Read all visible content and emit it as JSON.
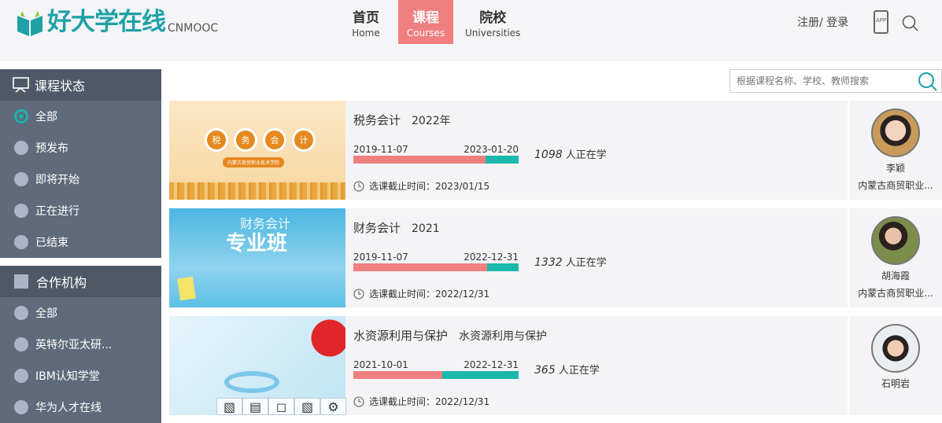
{
  "header": {
    "logo_text": "好大学在线",
    "logo_en": "CNMOOC",
    "nav": [
      {
        "zh": "首页",
        "en": "Home"
      },
      {
        "zh": "课程",
        "en": "Courses",
        "active": true
      },
      {
        "zh": "院校",
        "en": "Universities"
      }
    ],
    "login": "注册/ 登录",
    "app_label": "APP",
    "accent": "#f08080",
    "brand": "#1fa1a6"
  },
  "sidebar": {
    "status": {
      "title": "课程状态",
      "items": [
        "全部",
        "预发布",
        "即将开始",
        "正在进行",
        "已结束"
      ],
      "selected": "全部"
    },
    "org": {
      "title": "合作机构",
      "items": [
        "全部",
        "英特尔亚太研...",
        "IBM认知学堂",
        "华为人才在线"
      ]
    }
  },
  "search": {
    "placeholder": "根据课程名称、学校、教师搜索"
  },
  "courses": [
    {
      "title": "税务会计",
      "subtitle": "2022年",
      "start": "2019-11-07",
      "end": "2023-01-20",
      "progress": 0.8,
      "count": "1098",
      "count_label": "人正在学",
      "deadline": "选课截止时间：2023/01/15",
      "teacher": "李颖",
      "school": "内蒙古商贸职业...",
      "thumb_text": [
        "税",
        "务",
        "会",
        "计"
      ],
      "thumb_sub": "内蒙古商贸职业技术学院"
    },
    {
      "title": "财务会计",
      "subtitle": "2021",
      "start": "2019-11-07",
      "end": "2022-12-31",
      "progress": 0.81,
      "count": "1332",
      "count_label": "人正在学",
      "deadline": "选课截止时间：2022/12/31",
      "teacher": "胡海霞",
      "school": "内蒙古商贸职业...",
      "thumb_text": [
        "财务会计",
        "专业班"
      ]
    },
    {
      "title": "水资源利用与保护",
      "subtitle": "水资源利用与保护",
      "start": "2021-10-01",
      "end": "2022-12-31",
      "progress": 0.54,
      "count": "365",
      "count_label": "人正在学",
      "deadline": "选课截止时间：2022/12/31",
      "teacher": "石明岩",
      "school": ""
    }
  ]
}
